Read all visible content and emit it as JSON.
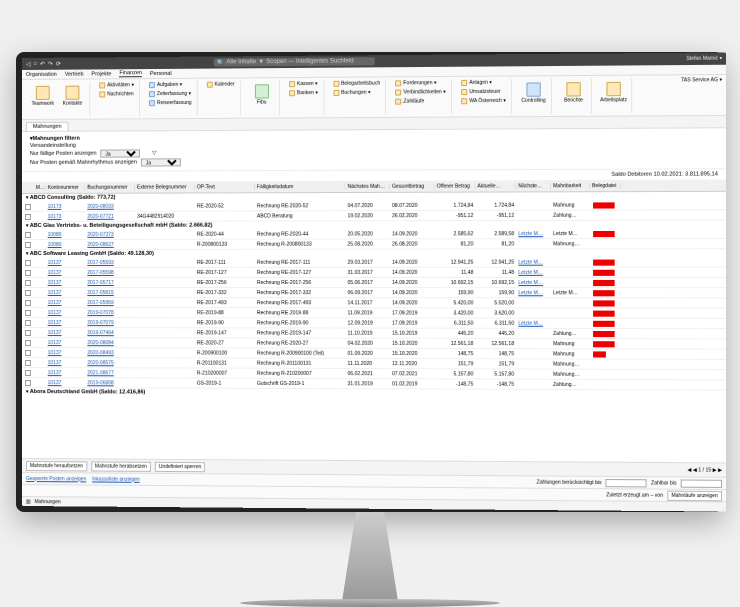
{
  "titlebar": {
    "search_placeholder": "Alle Inhalte",
    "search_scope": "Scopen — Intelligentes Suchfeld",
    "user": "Stefan Mamić ▾"
  },
  "menubar": [
    "Organisation",
    "Vertrieb",
    "Projekte",
    "Finanzen",
    "Personal"
  ],
  "menubar_active": 3,
  "ribbon": {
    "peers": [
      {
        "label": "Teamwork"
      },
      {
        "label": "Kontakte"
      }
    ],
    "tasks": [
      {
        "label": "Aktivitäten ▾"
      },
      {
        "label": "Nachrichten"
      },
      {
        "label": "Aufgaben ▾"
      },
      {
        "label": "Zeiterfassung ▾"
      },
      {
        "label": "Reiseerfassung"
      },
      {
        "label": "Kalender"
      }
    ],
    "fibu_label": "Fibu",
    "fibu": [
      {
        "label": "Kassen ▾"
      },
      {
        "label": "Banken ▾"
      },
      {
        "label": "Belegarbeitsbuch"
      },
      {
        "label": "Buchungen ▾"
      }
    ],
    "pay": [
      {
        "label": "Forderungen ▾"
      },
      {
        "label": "Verbindlichkeiten ▾"
      },
      {
        "label": "Zahlläufe"
      },
      {
        "label": "Anlagen ▾"
      },
      {
        "label": "Umsatzsteuer"
      },
      {
        "label": "WA Österreich ▾"
      }
    ],
    "ctrl": [
      {
        "label": "Controlling"
      },
      {
        "label": "Berichte"
      },
      {
        "label": "Arbeitsplatz"
      }
    ],
    "right": "TAS Service AG ▾"
  },
  "tab": "Mahnungen",
  "filters": {
    "title": "▾Mahnungen filtern",
    "sub": "Versandeinstellung",
    "row1": "Nur fällige Posten anzeigen",
    "row1_val": "Ja",
    "row2": "Nur Posten gemäß Mahnrhythmus anzeigen",
    "row2_val": "Ja"
  },
  "saldo": "Saldo Debitoren 10.02.2021: 3.811.895,14",
  "columns": [
    "",
    "Mahnsch…",
    "Kontonummer",
    "Buchungsnummer",
    "Externe Belegnummer",
    "OP-Text",
    "Fälligkeitsdatum",
    "Nächstes Mahndatum",
    "Gesamtbetrag",
    "Offener Betrag",
    "Aktuelle…",
    "Nächste…",
    "Mahnbarkeit",
    "Belegdatei"
  ],
  "groups": [
    {
      "title": "ABCD Consulting (Saldo: 773,72)",
      "rows": [
        {
          "konto": "10173",
          "buch": "2020-08033",
          "ext": "",
          "op": "RE-2020-52",
          "optxt": "Rechnung RE-2020-52",
          "faell": "04.07.2020",
          "next": "08.07.2020",
          "ges": "1.724,84",
          "off": "1.724,84",
          "akt": "",
          "nxt": "Mahnung",
          "bar": "full"
        },
        {
          "konto": "10173",
          "buch": "2020-07721",
          "ext": "34G4482914020",
          "op": "",
          "optxt": "ABCD Beratung",
          "faell": "19.02.2020",
          "next": "26.02.2020",
          "ges": "-951,12",
          "off": "-951,12",
          "akt": "",
          "nxt": "Zahlung…",
          "bar": ""
        }
      ]
    },
    {
      "title": "ABC Glas Vertriebs- u. Beteiligungsgesellschaft mbH (Saldo: 2.666,82)",
      "rows": [
        {
          "konto": "10080",
          "buch": "2020-07373",
          "ext": "",
          "op": "RE-2020-44",
          "optxt": "Rechnung RE-2020-44",
          "faell": "20.05.2020",
          "next": "14.09.2020",
          "ges": "2.585,62",
          "off": "2.589,58",
          "akt": "Letzte M…",
          "nxt": "Letzte M…",
          "bar": "full",
          "file": "10080…"
        },
        {
          "konto": "10080",
          "buch": "2020-08627",
          "ext": "",
          "op": "R-200800133",
          "optxt": "Rechnung R-200800133",
          "faell": "25.08.2020",
          "next": "26.08.2020",
          "ges": "81,20",
          "off": "81,20",
          "akt": "",
          "nxt": "Mahnung…",
          "bar": ""
        }
      ]
    },
    {
      "title": "ABC Software Leasing GmbH (Saldo: 49.128,30)",
      "rows": [
        {
          "konto": "10137",
          "buch": "2017-05593",
          "ext": "",
          "op": "RE-2017-111",
          "optxt": "Rechnung RE-2017-111",
          "faell": "29.03.2017",
          "next": "14.09.2020",
          "ges": "12.941,25",
          "off": "12.941,25",
          "akt": "Letzte M…",
          "nxt": "",
          "bar": "full"
        },
        {
          "konto": "10137",
          "buch": "2017-05598",
          "ext": "",
          "op": "RE-2017-127",
          "optxt": "Rechnung RE-2017-127",
          "faell": "31.03.2017",
          "next": "14.09.2020",
          "ges": "11,48",
          "off": "11,48",
          "akt": "Letzte M…",
          "nxt": "",
          "bar": "full"
        },
        {
          "konto": "10137",
          "buch": "2017-05717",
          "ext": "",
          "op": "RE-2017-256",
          "optxt": "Rechnung RE-2017-256",
          "faell": "05.06.2017",
          "next": "14.09.2020",
          "ges": "10.692,15",
          "off": "10.692,15",
          "akt": "Letzte M…",
          "nxt": "",
          "bar": "full",
          "file": "10137…"
        },
        {
          "konto": "10137",
          "buch": "2017-05815",
          "ext": "",
          "op": "RE-2017-332",
          "optxt": "Rechnung RE-2017-332",
          "faell": "06.09.2017",
          "next": "14.09.2020",
          "ges": "159,90",
          "off": "159,90",
          "akt": "Letzte M…",
          "nxt": "Letzte M…",
          "bar": "full",
          "file": "10137…"
        },
        {
          "konto": "10137",
          "buch": "2017-05959",
          "ext": "",
          "op": "RE-2017-493",
          "optxt": "Rechnung RE-2017-493",
          "faell": "14.11.2017",
          "next": "14.09.2020",
          "ges": "5.420,00",
          "off": "5.520,00",
          "akt": "",
          "nxt": "",
          "bar": "full",
          "file": "10137…"
        },
        {
          "konto": "10137",
          "buch": "2019-07078",
          "ext": "",
          "op": "RE-2019-88",
          "optxt": "Rechnung RE-2019-88",
          "faell": "11.09.2019",
          "next": "17.09.2019",
          "ges": "3.420,00",
          "off": "3.620,00",
          "akt": "",
          "nxt": "",
          "bar": "full"
        },
        {
          "konto": "10137",
          "buch": "2019-07079",
          "ext": "",
          "op": "RE-2019-90",
          "optxt": "Rechnung RE-2019-90",
          "faell": "12.09.2019",
          "next": "17.09.2019",
          "ges": "6.311,50",
          "off": "6.311,50",
          "akt": "Letzte M…",
          "nxt": "",
          "bar": "full"
        },
        {
          "konto": "10137",
          "buch": "2019-07464",
          "ext": "",
          "op": "RE-2019-147",
          "optxt": "Rechnung RE-2019-147",
          "faell": "11.10.2019",
          "next": "15.10.2019",
          "ges": "445,20",
          "off": "445,20",
          "akt": "",
          "nxt": "Zahlung…",
          "bar": "full",
          "file": "10137…"
        },
        {
          "konto": "10137",
          "buch": "2020-08084",
          "ext": "",
          "op": "RE-2020-27",
          "optxt": "Rechnung RE-2020-27",
          "faell": "04.02.2020",
          "next": "15.10.2020",
          "ges": "12.561,18",
          "off": "12.561,18",
          "akt": "",
          "nxt": "Mahnung",
          "bar": "full"
        },
        {
          "konto": "10137",
          "buch": "2020-08493",
          "ext": "",
          "op": "R-200900100",
          "optxt": "Rechnung R-200900100 (Teil)",
          "faell": "01.09.2020",
          "next": "15.10.2020",
          "ges": "148,75",
          "off": "148,75",
          "akt": "",
          "nxt": "Mahnung",
          "bar": "partial",
          "file": "10137…"
        },
        {
          "konto": "10137",
          "buch": "2020-08575",
          "ext": "",
          "op": "R-201100131",
          "optxt": "Rechnung R-201100131",
          "faell": "11.11.2020",
          "next": "12.11.2020",
          "ges": "151,79",
          "off": "151,79",
          "akt": "",
          "nxt": "Mahnung…",
          "bar": ""
        },
        {
          "konto": "10137",
          "buch": "2021-08677",
          "ext": "",
          "op": "R-210200007",
          "optxt": "Rechnung R-210200007",
          "faell": "06.02.2021",
          "next": "07.02.2021",
          "ges": "5.157,80",
          "off": "5.157,80",
          "akt": "",
          "nxt": "Mahnung…",
          "bar": ""
        },
        {
          "konto": "10137",
          "buch": "2019-06808",
          "ext": "",
          "op": "GS-2019-1",
          "optxt": "Gutschrift GS-2019-1",
          "faell": "31.01.2019",
          "next": "01.02.2019",
          "ges": "-148,75",
          "off": "-148,75",
          "akt": "",
          "nxt": "Zahlung…",
          "bar": "",
          "file": "10137…"
        }
      ]
    },
    {
      "title": "Abora Deutschland GmbH (Saldo: 12.416,86)",
      "rows": []
    }
  ],
  "footer": {
    "btn1": "Mahnstufe heraufsetzen",
    "btn2": "Mahnstufe herabsetzen",
    "btn3": "Undefiniert sperren",
    "pager": "◀ ◀ 1 / 15 ▶ ▶"
  },
  "bottombar": {
    "link1": "Gesperrte Posten anzeigen",
    "link2": "Inkassoliste anzeigen",
    "r1": "Zahlungen berücksichtigt bis",
    "r2": "Zahlbar bis",
    "r3": "Zuletzt erzeugt am – von",
    "btn": "Mahnläufe anzeigen"
  },
  "status": {
    "tab": "Mahnungen"
  }
}
